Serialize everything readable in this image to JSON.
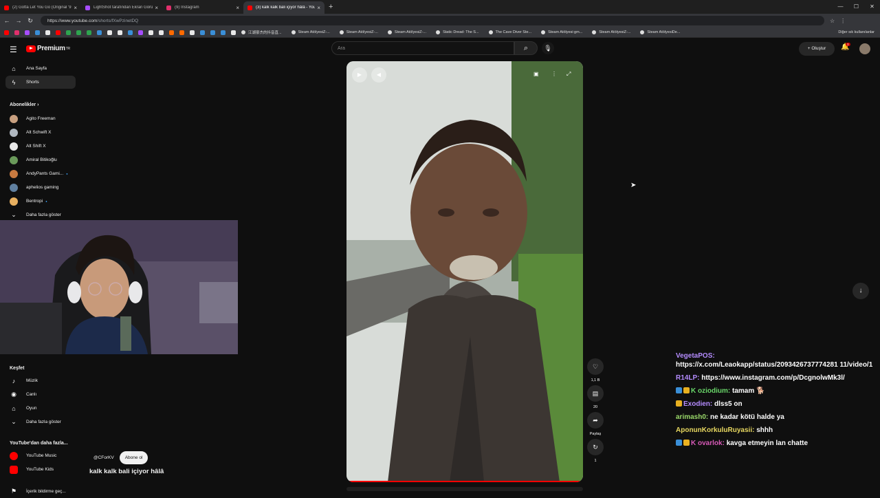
{
  "browser": {
    "tabs": [
      {
        "title": "(2) Gotta Let You Go (Original '91...",
        "color": "#ff0000",
        "active": false
      },
      {
        "title": "LightShot tarafından Ekran Görünt...",
        "color": "#a64dff",
        "active": false
      },
      {
        "title": "(9) Instagram",
        "color": "#e1306c",
        "active": false
      },
      {
        "title": "(3) kalk kalk bali içiyor hâlâ - YouT...",
        "color": "#ff0000",
        "active": true
      }
    ],
    "url_prefix": "https://www.youtube.com",
    "url_path": "/shorts/fXwPzinetDQ",
    "bookmarks": [
      "江湖豪杰的抖音直...",
      "Steam AtölyesiZ-...",
      "Steam AtölyesiZ-...",
      "Steam AtölyesiZ-...",
      "Static Dread: The S...",
      "The Cave Diver Ste...",
      "Steam Atölyesi:gm...",
      "Steam AtölyesiZ-...",
      "Steam AtölyesiDe..."
    ],
    "bookmarks_other": "Diğer sık kullanılanlar"
  },
  "header": {
    "logo_text": "Premium",
    "logo_sup": "TR",
    "search_placeholder": "Ara",
    "create_label": "Oluştur",
    "notification_count": "3"
  },
  "sidebar": {
    "home": "Ana Sayfa",
    "shorts": "Shorts",
    "subscriptions_title": "Abonelikler",
    "channels": [
      {
        "name": "Agito Freeman",
        "color": "#c8a080",
        "live": false
      },
      {
        "name": "Alt Schwift X",
        "color": "#b0b8c0",
        "live": false
      },
      {
        "name": "Alt Shift X",
        "color": "#e8e8e8",
        "live": false
      },
      {
        "name": "Amiral Bitikoğlu",
        "color": "#6a9a5a",
        "live": false
      },
      {
        "name": "AndyPants Gami...",
        "color": "#c87a40",
        "live": true
      },
      {
        "name": "aphelios gaming",
        "color": "#6080a0",
        "live": false
      },
      {
        "name": "Bentropi",
        "color": "#e8b060",
        "live": true
      }
    ],
    "show_more": "Daha fazla göster",
    "explore_title": "Keşfet",
    "explore": [
      {
        "label": "Müzik",
        "icon": "♪"
      },
      {
        "label": "Canlı",
        "icon": "◉"
      },
      {
        "label": "Oyun",
        "icon": "⌂"
      }
    ],
    "show_more_2": "Daha fazla göster",
    "more_title": "YouTube'dan daha fazla...",
    "more_items": [
      "YouTube Music",
      "YouTube Kids"
    ],
    "footer_item": "İçerik bildirme geç..."
  },
  "short": {
    "channel_handle": "@CForKV",
    "subscribe_label": "Abone ol",
    "title": "kalk kalk bali içiyor hâlâ",
    "likes": "1,1 B",
    "comments": "20",
    "share_label": "Paylaş",
    "remix_count": "1"
  },
  "chat": [
    {
      "user": "VegetaPOS:",
      "color": "#b58cff",
      "text": "https://x.com/Leaokapp/status/2093426737774281 11/video/1",
      "badges": []
    },
    {
      "user": "R14LP:",
      "color": "#b58cff",
      "text": "https://www.instagram.com/p/DcgnolwMk3l/",
      "badges": []
    },
    {
      "user": "K oziodium:",
      "color": "#6ad86a",
      "text": "tamam 🐕",
      "badges": [
        "#3a8fd8",
        "#e8b020"
      ]
    },
    {
      "user": "Exodien:",
      "color": "#b58cff",
      "text": "dlss5 on",
      "badges": [
        "#e8b020"
      ]
    },
    {
      "user": "arimash0:",
      "color": "#9ad86a",
      "text": "ne kadar kötü halde ya",
      "badges": []
    },
    {
      "user": "AponunKorkuluRuyasii:",
      "color": "#e8d860",
      "text": "shhh",
      "badges": []
    },
    {
      "user": "K ovarlok:",
      "color": "#d85ab8",
      "text": "kavga etmeyin lan chatte",
      "badges": [
        "#3a8fd8",
        "#e8b020"
      ]
    }
  ]
}
